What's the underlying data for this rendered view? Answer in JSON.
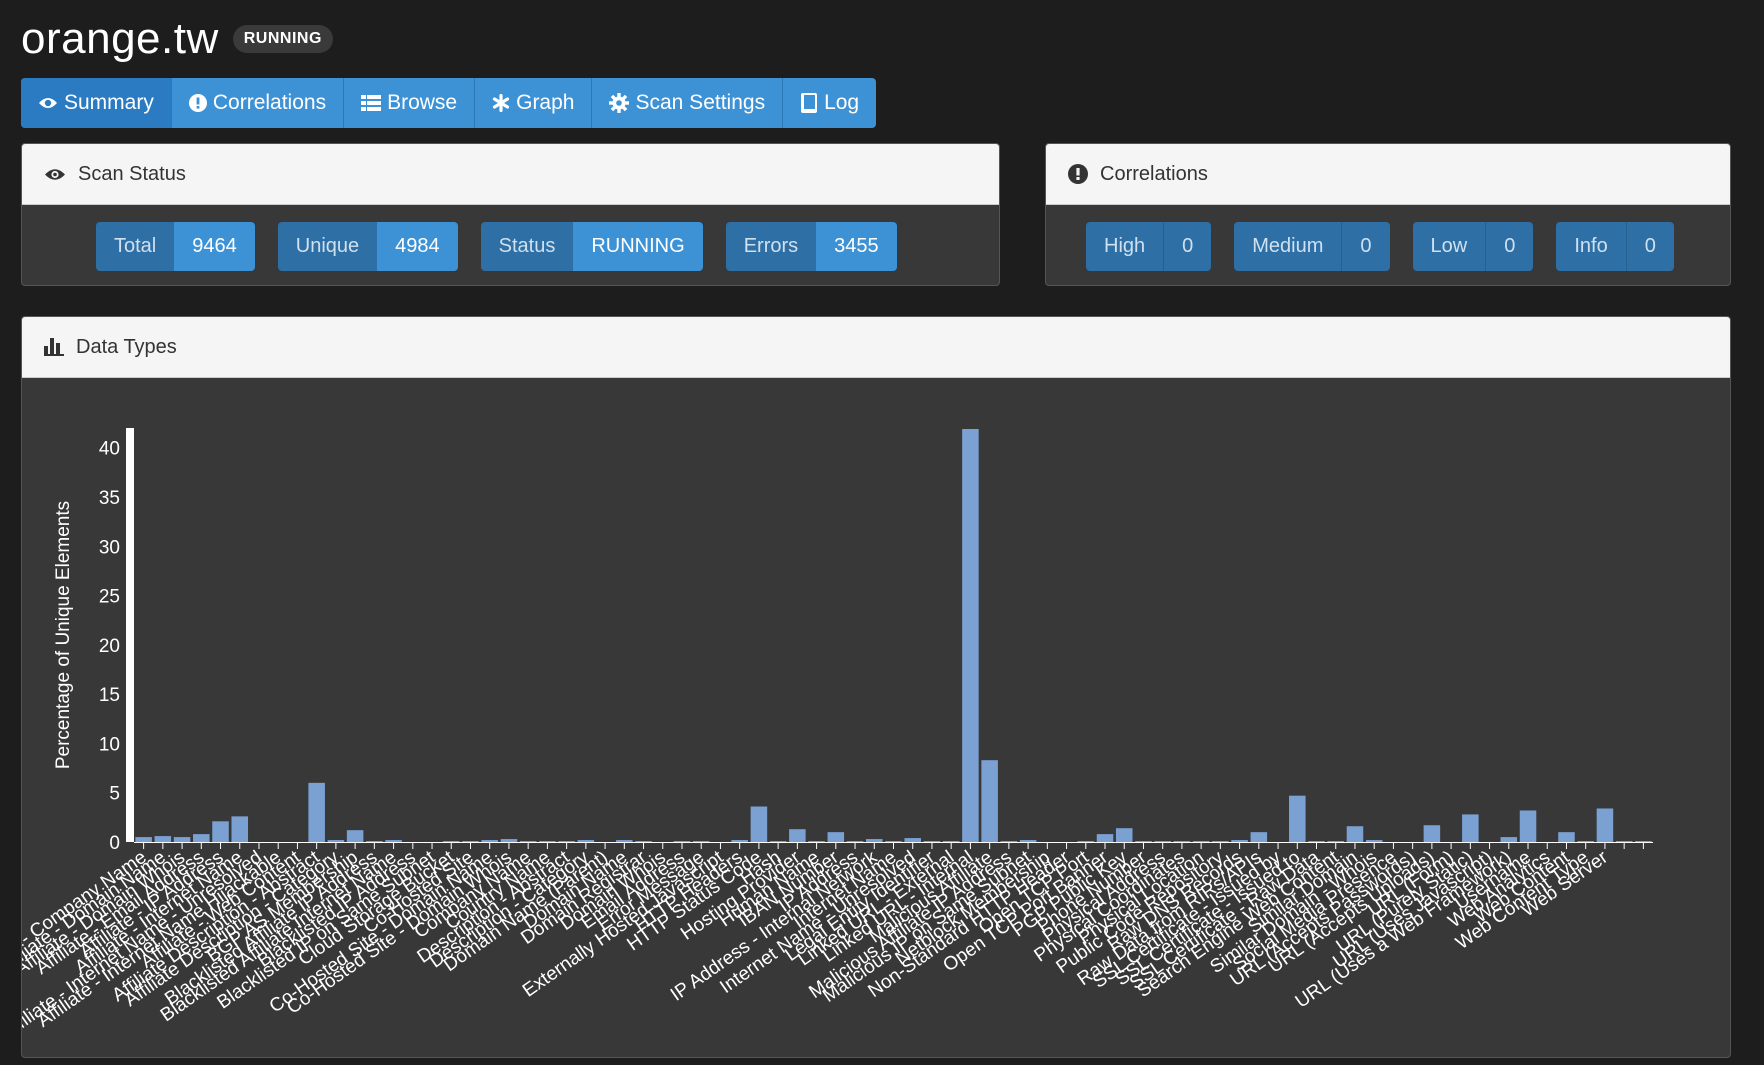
{
  "header": {
    "title": "orange.tw",
    "status_badge": "RUNNING"
  },
  "tabs": [
    {
      "label": "Summary",
      "icon": "eye-icon",
      "active": true
    },
    {
      "label": "Correlations",
      "icon": "exclamation-circle-icon",
      "active": false
    },
    {
      "label": "Browse",
      "icon": "list-icon",
      "active": false
    },
    {
      "label": "Graph",
      "icon": "asterisk-icon",
      "active": false
    },
    {
      "label": "Scan Settings",
      "icon": "gear-icon",
      "active": false
    },
    {
      "label": "Log",
      "icon": "book-icon",
      "active": false
    }
  ],
  "scan_status": {
    "title": "Scan Status",
    "stats": [
      {
        "label": "Total",
        "value": "9464"
      },
      {
        "label": "Unique",
        "value": "4984"
      },
      {
        "label": "Status",
        "value": "RUNNING"
      },
      {
        "label": "Errors",
        "value": "3455"
      }
    ]
  },
  "correlations": {
    "title": "Correlations",
    "stats": [
      {
        "label": "High",
        "value": "0"
      },
      {
        "label": "Medium",
        "value": "0"
      },
      {
        "label": "Low",
        "value": "0"
      },
      {
        "label": "Info",
        "value": "0"
      }
    ]
  },
  "data_types": {
    "title": "Data Types"
  },
  "colors": {
    "accent": "#3d92d6",
    "accent_dark": "#2e6fa6",
    "bar": "#7ba0d2",
    "panel_bg": "#383838"
  },
  "chart_data": {
    "type": "bar",
    "title": "",
    "ylabel": "Percentage of Unique Elements",
    "xlabel": "",
    "ylim": [
      0,
      42
    ],
    "yticks": [
      0,
      5,
      10,
      15,
      20,
      25,
      30,
      35,
      40
    ],
    "categories": [
      "Affiliate - Company Name",
      "Affiliate - Domain Name",
      "Affiliate - Domain Whois",
      "Affiliate - Email Address",
      "Affiliate - IP Address",
      "Affiliate - Internet Name",
      "Affiliate - Internet Name - Unresolved",
      "Affiliate - Internet Name Hijackable",
      "Affiliate - Web Content",
      "Affiliate Description - Abstract",
      "Affiliate Description - Category",
      "BGP AS Membership",
      "Blacklisted Affiliate IP Address",
      "Blacklisted Affiliate Internet Name",
      "Blacklisted IP Address",
      "Blacklisted IP on Same Subnet",
      "Cloud Storage Bucket",
      "Co-Hosted Site",
      "Co-Hosted Site - Domain Name",
      "Co-Hosted Site - Domain Whois",
      "Company Name",
      "Country Name",
      "Description - Abstract",
      "Description - Category",
      "Domain Name (Parent)",
      "Domain Name",
      "Domain Registrar",
      "Domain Whois",
      "Email Address",
      "Error Message",
      "Externally Hosted Javascript",
      "HTTP Headers",
      "HTTP Status Code",
      "Hash",
      "Hosting Provider",
      "Human Name",
      "IBAN Number",
      "IP Address",
      "IP Address - Internal Network",
      "Internet Name",
      "Internet Name - Unresolved",
      "Legal Entity Identifier",
      "Linked URL - External",
      "Linked URL - Internal",
      "Malicious Affiliate",
      "Malicious Affiliate IP Address",
      "Malicious IP on Same Subnet",
      "Netblock Membership",
      "Non-Standard HTTP Header",
      "Open TCP Port",
      "Open TCP Port Banner",
      "PGP Public Key",
      "Phone Number",
      "Physical Address",
      "Physical Coordinates",
      "Physical Location",
      "Public Code Repository",
      "Raw DNS Records",
      "Raw Data from RIRs/APIs",
      "SSL Certificate - Issued by",
      "SSL Certificate - Issued to",
      "SSL Certificate - Raw Data",
      "Search Engine Web Content",
      "Similar Domain",
      "Similar Domain - Whois",
      "Social Media Presence",
      "URL (Accepts Passwords)",
      "URL (Accepts Uploads)",
      "URL (Form)",
      "URL (Purely Static)",
      "URL (Uses Javascript)",
      "URL (Uses a Web Framework)",
      "Username",
      "Web Analytics",
      "Web Content",
      "Web Content Type",
      "Web Server"
    ],
    "values": [
      0.5,
      0.6,
      0.5,
      0.8,
      2.1,
      2.6,
      0,
      0,
      0,
      6.0,
      0.2,
      1.2,
      0.1,
      0.2,
      0,
      0,
      0.1,
      0.1,
      0.2,
      0.3,
      0.1,
      0.1,
      0.1,
      0.2,
      0,
      0.2,
      0.1,
      0,
      0.1,
      0.1,
      0,
      0.2,
      3.6,
      0.1,
      1.3,
      0.1,
      1.0,
      0.1,
      0.3,
      0.1,
      0.4,
      0.1,
      0.1,
      41.9,
      8.3,
      0.1,
      0.2,
      0,
      0,
      0.1,
      0.8,
      1.4,
      0.1,
      0.1,
      0.1,
      0.1,
      0.1,
      0.2,
      1.0,
      0,
      4.7,
      0.1,
      0.1,
      1.6,
      0.2,
      0,
      0,
      1.7,
      0,
      2.8,
      0,
      0.5,
      3.2,
      0,
      1.0,
      0.1,
      3.4,
      0.1,
      0.1
    ]
  }
}
